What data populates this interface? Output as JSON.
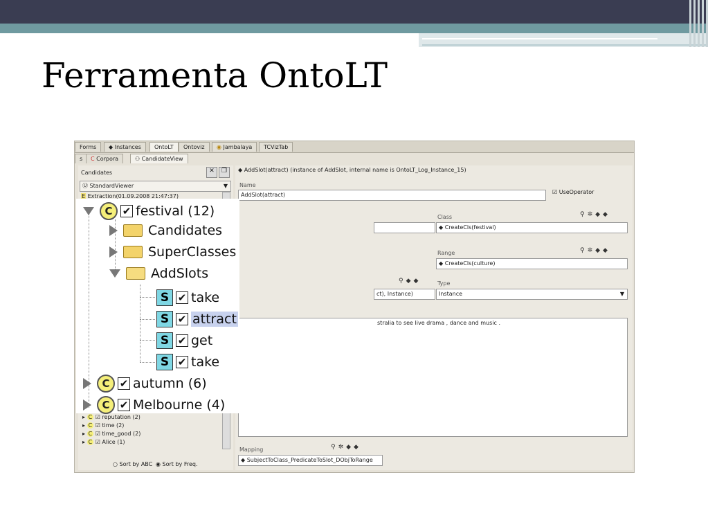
{
  "slide": {
    "title": "Ferramenta OntoLT"
  },
  "app": {
    "tabs": [
      "Forms",
      "Instances",
      "OntoLT",
      "Ontoviz",
      "Jambalaya",
      "TCVizTab"
    ],
    "subtabs": [
      "s",
      "Corpora",
      "CandidateView"
    ],
    "left": {
      "header": "Candidates",
      "viewer": "StandardViewer",
      "extraction": "Extraction(01.09.2008 21:47:37)",
      "small_items": [
        "reputation (2)",
        "time (2)",
        "time_good (2)",
        "Alice (1)"
      ],
      "sort_abc": "Sort by ABC",
      "sort_freq": "Sort by Freq."
    },
    "tree": {
      "root": "festival (12)",
      "folders": [
        "Candidates",
        "SuperClasses",
        "AddSlots"
      ],
      "slots": [
        "take",
        "attract",
        "get",
        "take"
      ],
      "siblings": [
        "autumn (6)",
        "Melbourne (4)"
      ]
    },
    "right": {
      "header": "AddSlot(attract)   (instance of AddSlot, internal name is OntoLT_Log_Instance_15)",
      "name_label": "Name",
      "name_value": "AddSlot(attract)",
      "use_operator": "UseOperator",
      "class_label": "Class",
      "class_value": "CreateCls(festival)",
      "range_label": "Range",
      "range_value": "CreateCls(culture)",
      "type_label": "Type",
      "type_value": "Instance",
      "partial_field": "ct), Instance)",
      "text_snippet": "stralia to see live drama , dance and music .",
      "mapping_label": "Mapping",
      "mapping_value": "SubjectToClass_PredicateToSlot_DObjToRange"
    }
  }
}
